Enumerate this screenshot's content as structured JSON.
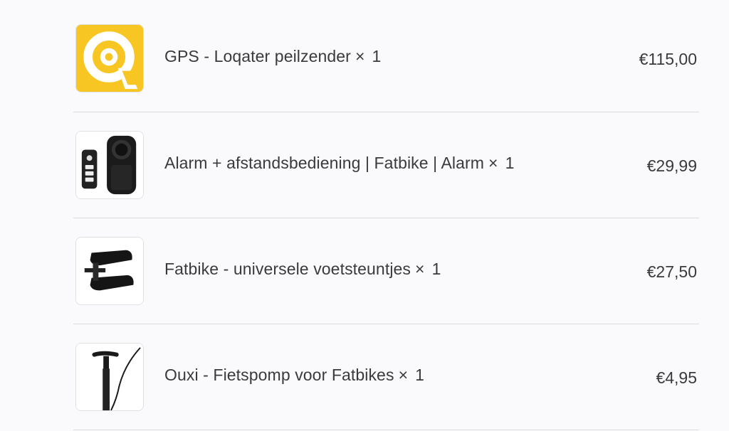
{
  "cart": {
    "items": [
      {
        "name": "GPS - Loqater peilzender",
        "qty_symbol": "×",
        "qty": "1",
        "price": "€115,00",
        "thumbnail_icon": "loqater-logo-icon"
      },
      {
        "name": "Alarm + afstandsbediening | Fatbike | Alarm",
        "qty_symbol": "×",
        "qty": "1",
        "price": "€29,99",
        "thumbnail_icon": "alarm-remote-icon"
      },
      {
        "name": "Fatbike - universele voetsteuntjes",
        "qty_symbol": "×",
        "qty": "1",
        "price": "€27,50",
        "thumbnail_icon": "footpegs-icon"
      },
      {
        "name": "Ouxi - Fietspomp voor Fatbikes",
        "qty_symbol": "×",
        "qty": "1",
        "price": "€4,95",
        "thumbnail_icon": "bike-pump-icon"
      }
    ]
  },
  "colors": {
    "background": "#fafafc",
    "text": "#3a3a3d",
    "divider": "#dcdcdf",
    "brand_yellow": "#f7c623"
  }
}
